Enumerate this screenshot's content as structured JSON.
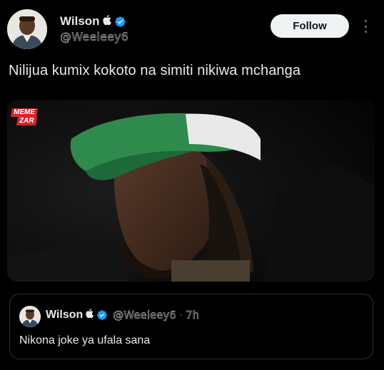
{
  "post": {
    "author": {
      "display_name": "Wilson",
      "name_suffix_icon": "apple-icon",
      "verified": true,
      "handle": "@Weeleey6"
    },
    "follow_label": "Follow",
    "more_icon": "more-vertical-icon",
    "text": "Nilijua kumix kokoto na simiti nikiwa mchanga",
    "media": {
      "watermark_line1": "MEME",
      "watermark_line2": "ZAR"
    }
  },
  "quoted_post": {
    "author": {
      "display_name": "Wilson",
      "name_suffix_icon": "apple-icon",
      "verified": true,
      "handle": "@Weeleey6"
    },
    "separator": "·",
    "time": "7h",
    "text": "Nikona joke ya ufala sana"
  },
  "colors": {
    "background": "#000000",
    "text_primary": "#e7e9ea",
    "text_secondary": "#71767b",
    "verified_blue": "#1d9bf0",
    "follow_button_bg": "#eff3f4",
    "border": "#2f3336",
    "watermark_red": "#d6252c"
  }
}
